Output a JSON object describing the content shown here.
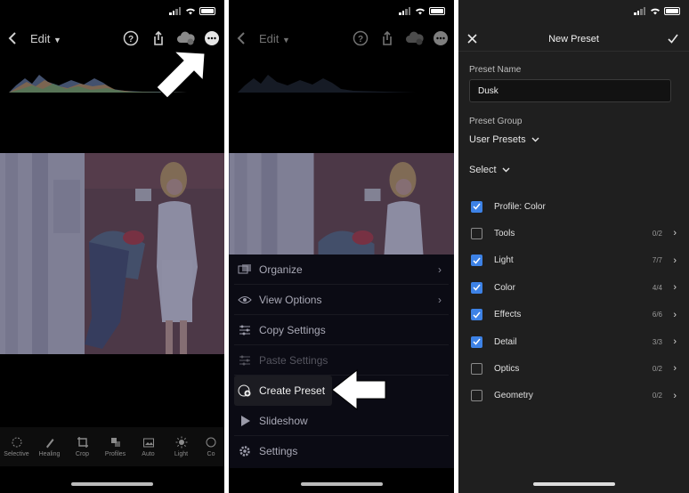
{
  "panel1": {
    "header": {
      "back_icon": "chevron-left-icon",
      "edit_label": "Edit",
      "icons": [
        "help-icon",
        "share-icon",
        "cloud-sync-icon",
        "more-icon"
      ]
    },
    "tools": [
      {
        "label": "Selective",
        "icon": "selective-icon"
      },
      {
        "label": "Healing",
        "icon": "brush-icon"
      },
      {
        "label": "Crop",
        "icon": "crop-icon"
      },
      {
        "label": "Profiles",
        "icon": "profiles-icon"
      },
      {
        "label": "Auto",
        "icon": "auto-icon"
      },
      {
        "label": "Light",
        "icon": "sun-icon"
      },
      {
        "label": "Co",
        "icon": "color-icon"
      }
    ]
  },
  "panel2": {
    "header": {
      "edit_label": "Edit"
    },
    "menu": [
      {
        "label": "Organize",
        "icon": "organize-icon",
        "chevron": true
      },
      {
        "label": "View Options",
        "icon": "view-options-icon",
        "chevron": true
      },
      {
        "label": "Copy Settings",
        "icon": "copy-settings-icon",
        "chevron": false
      },
      {
        "label": "Paste Settings",
        "icon": "paste-settings-icon",
        "chevron": false,
        "disabled": true
      },
      {
        "label": "Create Preset",
        "icon": "create-preset-icon",
        "chevron": false,
        "highlighted": true
      },
      {
        "label": "Slideshow",
        "icon": "play-icon",
        "chevron": false
      },
      {
        "label": "Settings",
        "icon": "gear-icon",
        "chevron": false
      }
    ]
  },
  "panel3": {
    "title": "New Preset",
    "name_label": "Preset Name",
    "name_value": "Dusk",
    "group_label": "Preset Group",
    "group_value": "User Presets",
    "select_label": "Select",
    "items": [
      {
        "label": "Profile: Color",
        "checked": true,
        "count": ""
      },
      {
        "label": "Tools",
        "checked": false,
        "count": "0/2"
      },
      {
        "label": "Light",
        "checked": true,
        "count": "7/7"
      },
      {
        "label": "Color",
        "checked": true,
        "count": "4/4"
      },
      {
        "label": "Effects",
        "checked": true,
        "count": "6/6"
      },
      {
        "label": "Detail",
        "checked": true,
        "count": "3/3"
      },
      {
        "label": "Optics",
        "checked": false,
        "count": "0/2"
      },
      {
        "label": "Geometry",
        "checked": false,
        "count": "0/2"
      }
    ],
    "accent": "#3d82e6"
  }
}
